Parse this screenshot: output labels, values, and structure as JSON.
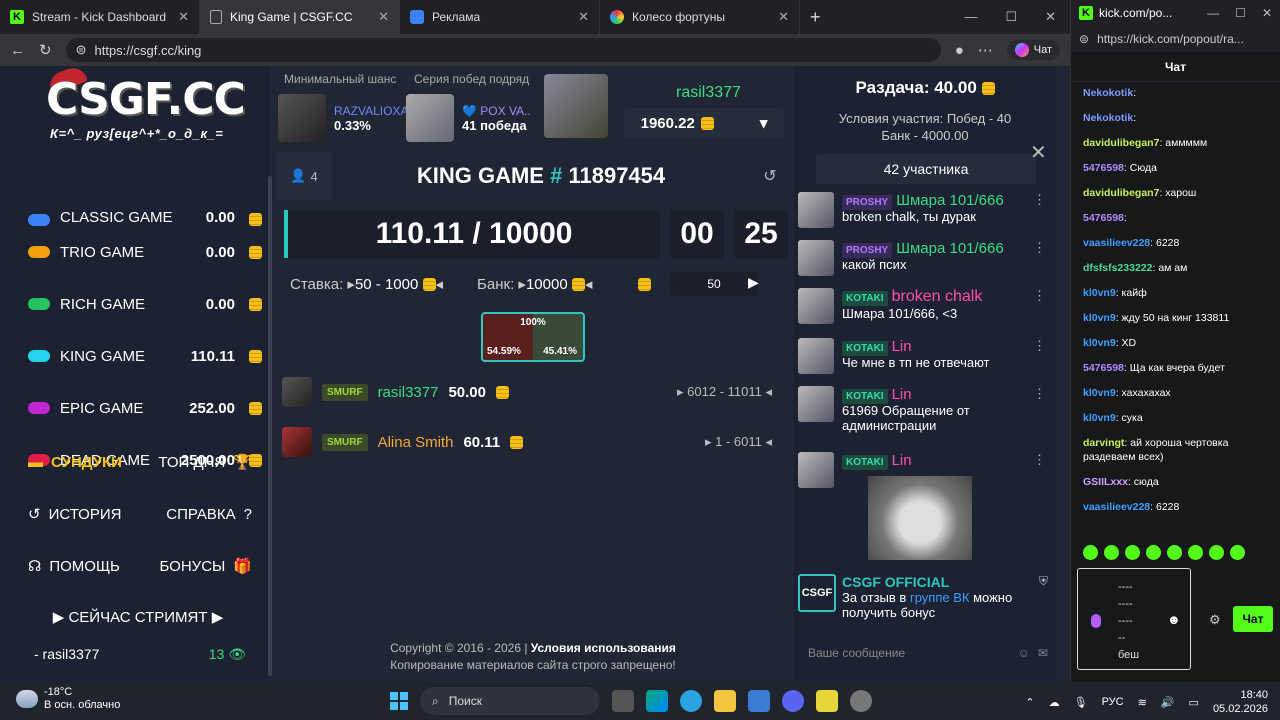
{
  "browser": {
    "tabs": [
      {
        "title": "Stream - Kick Dashboard",
        "icon": "kick-icon"
      },
      {
        "title": "King Game | CSGF.CC",
        "icon": "doc-icon"
      },
      {
        "title": "Реклама",
        "icon": "speaker-icon"
      },
      {
        "title": "Колесо фортуны",
        "icon": "wheel-icon"
      }
    ],
    "url": "https://csgf.cc/king",
    "chat_button": "Чат"
  },
  "site": {
    "logo": "CSGF.CC",
    "logo_sub": "К=^_ руз[ецг^+*_о_д_к_=",
    "top": {
      "min_chance_label": "Минимальный шанс",
      "streak_label": "Серия побед подряд",
      "min_chance_user": "RAZVALIOXA",
      "min_chance_value": "0.33%",
      "streak_user": "POX VA..",
      "streak_value": "41 победа",
      "username": "rasil3377",
      "balance": "1960.22"
    },
    "games": [
      {
        "name": "CLASSIC GAME",
        "value": "0.00",
        "color": "#3b82f6"
      },
      {
        "name": "TRIO GAME",
        "value": "0.00",
        "color": "#f59e0b"
      },
      {
        "name": "RICH GAME",
        "value": "0.00",
        "color": "#22c55e"
      },
      {
        "name": "KING GAME",
        "value": "110.11",
        "color": "#22d3ee"
      },
      {
        "name": "EPIC GAME",
        "value": "252.00",
        "color": "#c026d3"
      },
      {
        "name": "DEAD GAME",
        "value": "2500.00",
        "color": "#e11d48"
      }
    ],
    "menu": {
      "chests": "СУНДУКИ",
      "top_day": "ТОП ДНЯ",
      "history": "ИСТОРИЯ",
      "help_ref": "СПРАВКА",
      "support": "ПОМОЩЬ",
      "bonuses": "БОНУСЫ"
    },
    "streaming": {
      "title": "СЕЙЧАС СТРИМЯТ",
      "streamer": "- rasil3377",
      "viewers": "13"
    },
    "game": {
      "players": "4",
      "title": "KING GAME",
      "hash": "#",
      "number": "11897454",
      "score": "110.11 / 10000",
      "timer_min": "00",
      "timer_sec": "25",
      "bet_label": "Ставка:",
      "bet_range": "50 - 1000",
      "bank_label": "Банк:",
      "bank_value": "10000",
      "bet_input": "50",
      "pie_total": "100%",
      "pie_left": "54.59%",
      "pie_right": "45.41%",
      "bets": [
        {
          "badge": "SMURF",
          "name": "rasil3377",
          "amount": "50.00",
          "range": "6012 - 11011",
          "name_color": "#3ddc84"
        },
        {
          "badge": "SMURF",
          "name": "Alina Smith",
          "amount": "60.11",
          "range": "1 - 6011",
          "name_color": "#f6a93b"
        }
      ]
    },
    "footer": {
      "copyright": "Copyright © 2016 - 2026 |",
      "terms": "Условия использования",
      "notice": "Копирование материалов сайта строго запрещено!"
    },
    "giveaway": {
      "title": "Раздача: 40.00",
      "cond1": "Условия участия: Побед - 40",
      "cond2": "Банк - 4000.00",
      "participants": "42 участника"
    },
    "chat": [
      {
        "badge": "PROSHY",
        "name": "Шмара 101/666",
        "text": "broken chalk, ты дурак"
      },
      {
        "badge": "PROSHY",
        "name": "Шмара 101/666",
        "text": "какой псих"
      },
      {
        "badge": "KOTAKI",
        "name": "broken chalk",
        "text": "Шмара 101/666, <3"
      },
      {
        "badge": "KOTAKI",
        "name": "Lin",
        "text": "Че мне в тп не отвечают"
      },
      {
        "badge": "KOTAKI",
        "name": "Lin",
        "text": "61969 Обращение от администрации"
      },
      {
        "badge": "KOTAKI",
        "name": "Lin",
        "text": ""
      }
    ],
    "official": {
      "logo": "CSGF",
      "name": "CSGF OFFICIAL",
      "text1": "За отзыв в",
      "link": "группе ВК",
      "text2": "можно получить бонус"
    },
    "chat_placeholder": "Ваше сообщение"
  },
  "kick": {
    "title": "kick.com/po...",
    "url": "https://kick.com/popout/ra...",
    "header": "Чат",
    "messages": [
      {
        "user": "Nekokotik",
        "text": ""
      },
      {
        "user": "Nekokotik",
        "text": ""
      },
      {
        "user": "davidulibegan7",
        "text": "аммммм"
      },
      {
        "user": "5476598",
        "text": "Сюда"
      },
      {
        "user": "davidulibegan7",
        "text": "харош"
      },
      {
        "user": "5476598",
        "text": ""
      },
      {
        "user": "vaasilieev228",
        "text": "6228"
      },
      {
        "user": "dfsfsfs233222",
        "text": "ам ам"
      },
      {
        "user": "kl0vn9",
        "text": "кайф"
      },
      {
        "user": "kl0vn9",
        "text": "жду 50 на кинг 133811"
      },
      {
        "user": "kl0vn9",
        "text": "XD"
      },
      {
        "user": "5476598",
        "text": "Ща как вчера будет"
      },
      {
        "user": "kl0vn9",
        "text": "хахахахах"
      },
      {
        "user": "kl0vn9",
        "text": "сука"
      },
      {
        "user": "darvingt",
        "text": "ай хороша чертовка раздеваем всех)"
      },
      {
        "user": "GSIILxxx",
        "text": "сюда"
      },
      {
        "user": "vaasilieev228",
        "text": "6228"
      }
    ],
    "input_lines": [
      "----",
      "----",
      "----",
      "--",
      "беш"
    ],
    "send": "Чат"
  },
  "taskbar": {
    "temp": "-18°C",
    "weather": "В осн. облачно",
    "search": "Поиск",
    "lang": "РУС",
    "time": "18:40",
    "date": "05.02.2026"
  }
}
